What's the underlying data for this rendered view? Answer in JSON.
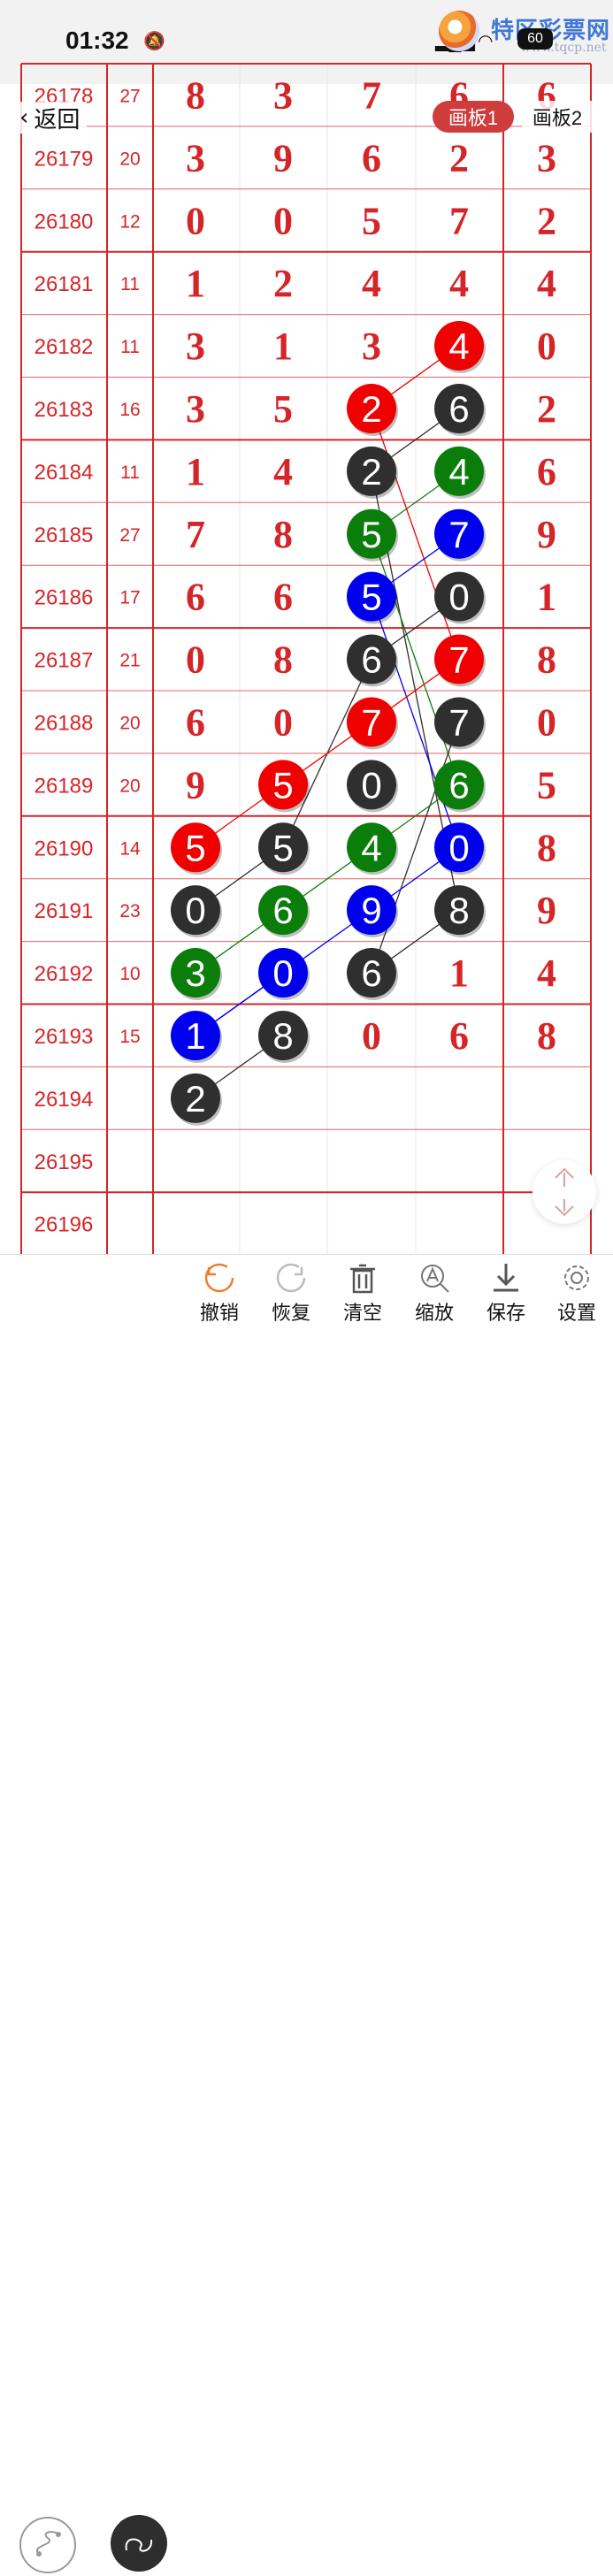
{
  "status": {
    "time": "01:32"
  },
  "brand": {
    "name": "特区彩票网",
    "url": "www.tqcp.net",
    "badge": "60"
  },
  "nav": {
    "back_label": "返回",
    "board1_label": "画板1",
    "board2_label": "画板2"
  },
  "table": {
    "rows": [
      {
        "issue": "26178",
        "sum": "27",
        "digits": [
          "8",
          "3",
          "7",
          "6",
          "6"
        ]
      },
      {
        "issue": "26179",
        "sum": "20",
        "digits": [
          "3",
          "9",
          "6",
          "2",
          "3"
        ]
      },
      {
        "issue": "26180",
        "sum": "12",
        "digits": [
          "0",
          "0",
          "5",
          "7",
          "2"
        ]
      },
      {
        "issue": "26181",
        "sum": "11",
        "digits": [
          "1",
          "2",
          "4",
          "4",
          "4"
        ]
      },
      {
        "issue": "26182",
        "sum": "11",
        "digits": [
          "3",
          "1",
          "3",
          "4",
          "0"
        ]
      },
      {
        "issue": "26183",
        "sum": "16",
        "digits": [
          "3",
          "5",
          "2",
          "6",
          "2"
        ]
      },
      {
        "issue": "26184",
        "sum": "11",
        "digits": [
          "1",
          "4",
          "2",
          "4",
          "6"
        ]
      },
      {
        "issue": "26185",
        "sum": "27",
        "digits": [
          "7",
          "8",
          "5",
          "7",
          "9"
        ]
      },
      {
        "issue": "26186",
        "sum": "17",
        "digits": [
          "6",
          "6",
          "5",
          "0",
          "1"
        ]
      },
      {
        "issue": "26187",
        "sum": "21",
        "digits": [
          "0",
          "8",
          "6",
          "7",
          "8"
        ]
      },
      {
        "issue": "26188",
        "sum": "20",
        "digits": [
          "6",
          "0",
          "7",
          "7",
          "0"
        ]
      },
      {
        "issue": "26189",
        "sum": "20",
        "digits": [
          "9",
          "5",
          "0",
          "6",
          "5"
        ]
      },
      {
        "issue": "26190",
        "sum": "14",
        "digits": [
          "5",
          "5",
          "4",
          "0",
          "8"
        ]
      },
      {
        "issue": "26191",
        "sum": "23",
        "digits": [
          "0",
          "6",
          "9",
          "8",
          "9"
        ]
      },
      {
        "issue": "26192",
        "sum": "10",
        "digits": [
          "3",
          "0",
          "6",
          "1",
          "4"
        ]
      },
      {
        "issue": "26193",
        "sum": "15",
        "digits": [
          "1",
          "8",
          "0",
          "6",
          "8"
        ]
      },
      {
        "issue": "26194",
        "sum": "",
        "digits": [
          "2",
          "",
          "",
          "",
          ""
        ]
      },
      {
        "issue": "26195",
        "sum": "",
        "digits": [
          "",
          "",
          "",
          "",
          ""
        ]
      },
      {
        "issue": "26196",
        "sum": "",
        "digits": [
          "",
          "",
          "",
          "",
          ""
        ]
      }
    ],
    "balls": [
      {
        "row": 4,
        "col": 3,
        "color": "red"
      },
      {
        "row": 5,
        "col": 2,
        "color": "red"
      },
      {
        "row": 5,
        "col": 3,
        "color": "black"
      },
      {
        "row": 6,
        "col": 2,
        "color": "black"
      },
      {
        "row": 6,
        "col": 3,
        "color": "green"
      },
      {
        "row": 7,
        "col": 2,
        "color": "green"
      },
      {
        "row": 7,
        "col": 3,
        "color": "blue"
      },
      {
        "row": 8,
        "col": 2,
        "color": "blue"
      },
      {
        "row": 8,
        "col": 3,
        "color": "black"
      },
      {
        "row": 9,
        "col": 2,
        "color": "black"
      },
      {
        "row": 9,
        "col": 3,
        "color": "red"
      },
      {
        "row": 10,
        "col": 2,
        "color": "red"
      },
      {
        "row": 10,
        "col": 3,
        "color": "black"
      },
      {
        "row": 11,
        "col": 1,
        "color": "red"
      },
      {
        "row": 11,
        "col": 2,
        "color": "black"
      },
      {
        "row": 11,
        "col": 3,
        "color": "green"
      },
      {
        "row": 12,
        "col": 0,
        "color": "red"
      },
      {
        "row": 12,
        "col": 1,
        "color": "black"
      },
      {
        "row": 12,
        "col": 2,
        "color": "green"
      },
      {
        "row": 12,
        "col": 3,
        "color": "blue"
      },
      {
        "row": 13,
        "col": 0,
        "color": "black"
      },
      {
        "row": 13,
        "col": 1,
        "color": "green"
      },
      {
        "row": 13,
        "col": 2,
        "color": "blue"
      },
      {
        "row": 13,
        "col": 3,
        "color": "black"
      },
      {
        "row": 14,
        "col": 0,
        "color": "green"
      },
      {
        "row": 14,
        "col": 1,
        "color": "blue"
      },
      {
        "row": 14,
        "col": 2,
        "color": "black"
      },
      {
        "row": 15,
        "col": 0,
        "color": "blue"
      },
      {
        "row": 15,
        "col": 1,
        "color": "black"
      },
      {
        "row": 16,
        "col": 0,
        "color": "black"
      }
    ],
    "links": [
      {
        "from": [
          4,
          3
        ],
        "to": [
          5,
          2
        ],
        "color": "red"
      },
      {
        "from": [
          5,
          2
        ],
        "to": [
          9,
          3
        ],
        "color": "red"
      },
      {
        "from": [
          5,
          3
        ],
        "to": [
          6,
          2
        ],
        "color": "black"
      },
      {
        "from": [
          6,
          2
        ],
        "to": [
          13,
          3
        ],
        "color": "black"
      },
      {
        "from": [
          6,
          3
        ],
        "to": [
          7,
          2
        ],
        "color": "green"
      },
      {
        "from": [
          7,
          2
        ],
        "to": [
          11,
          3
        ],
        "color": "green"
      },
      {
        "from": [
          7,
          3
        ],
        "to": [
          8,
          2
        ],
        "color": "blue"
      },
      {
        "from": [
          8,
          2
        ],
        "to": [
          12,
          3
        ],
        "color": "blue"
      },
      {
        "from": [
          8,
          3
        ],
        "to": [
          9,
          2
        ],
        "color": "black"
      },
      {
        "from": [
          9,
          2
        ],
        "to": [
          12,
          1
        ],
        "color": "black"
      },
      {
        "from": [
          9,
          3
        ],
        "to": [
          10,
          2
        ],
        "color": "red"
      },
      {
        "from": [
          10,
          3
        ],
        "to": [
          14,
          2
        ],
        "color": "black"
      },
      {
        "from": [
          10,
          2
        ],
        "to": [
          11,
          1
        ],
        "color": "red"
      },
      {
        "from": [
          11,
          1
        ],
        "to": [
          12,
          0
        ],
        "color": "red"
      },
      {
        "from": [
          11,
          3
        ],
        "to": [
          12,
          2
        ],
        "color": "green"
      },
      {
        "from": [
          12,
          2
        ],
        "to": [
          14,
          0
        ],
        "color": "green"
      },
      {
        "from": [
          12,
          3
        ],
        "to": [
          13,
          2
        ],
        "color": "blue"
      },
      {
        "from": [
          13,
          2
        ],
        "to": [
          15,
          0
        ],
        "color": "blue"
      },
      {
        "from": [
          12,
          1
        ],
        "to": [
          13,
          0
        ],
        "color": "black"
      },
      {
        "from": [
          13,
          3
        ],
        "to": [
          14,
          2
        ],
        "color": "black"
      },
      {
        "from": [
          14,
          1
        ],
        "to": [
          15,
          0
        ],
        "color": "blue"
      },
      {
        "from": [
          15,
          1
        ],
        "to": [
          16,
          0
        ],
        "color": "black"
      }
    ]
  },
  "colors": {
    "red": "#f00000",
    "black": "#2f2f2f",
    "green": "#0a7d0a",
    "blue": "#0000ee",
    "grid_red": "#d42528",
    "text_red": "#d42528"
  },
  "toolbar": {
    "undo_label": "撤销",
    "redo_label": "恢复",
    "clear_label": "清空",
    "zoom_label": "缩放",
    "save_label": "保存",
    "settings_label": "设置"
  }
}
